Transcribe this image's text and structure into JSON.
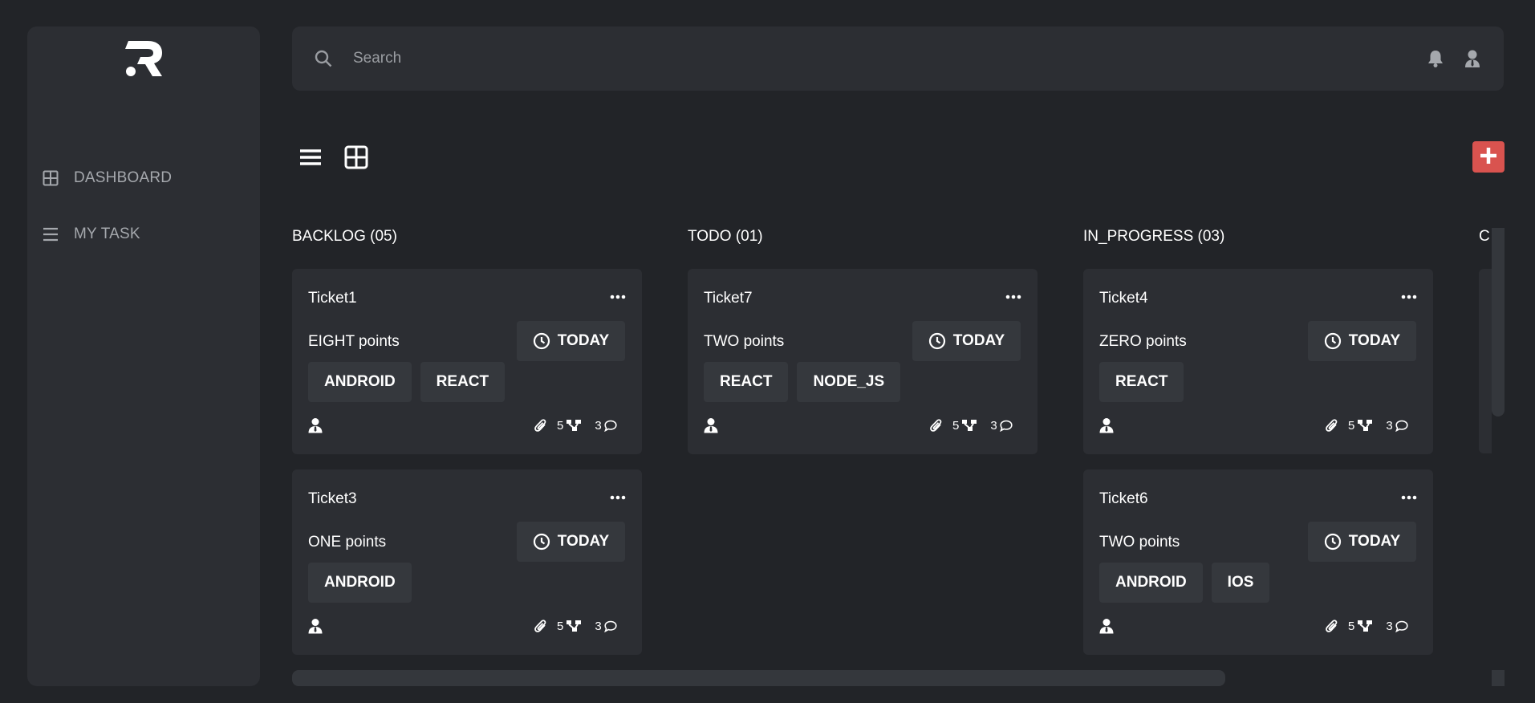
{
  "sidebar": {
    "logo": "R",
    "items": [
      {
        "label": "DASHBOARD",
        "icon": "grid-icon"
      },
      {
        "label": "MY TASK",
        "icon": "list-icon"
      }
    ]
  },
  "search": {
    "placeholder": "Search",
    "value": ""
  },
  "columns": [
    {
      "title": "BACKLOG (05)",
      "cards": [
        {
          "title": "Ticket1",
          "points": "EIGHT points",
          "due": "TODAY",
          "tags": [
            "ANDROID",
            "REACT"
          ],
          "subtasks": "5",
          "comments": "3"
        },
        {
          "title": "Ticket3",
          "points": "ONE points",
          "due": "TODAY",
          "tags": [
            "ANDROID"
          ],
          "subtasks": "5",
          "comments": "3"
        }
      ]
    },
    {
      "title": "TODO (01)",
      "cards": [
        {
          "title": "Ticket7",
          "points": "TWO points",
          "due": "TODAY",
          "tags": [
            "REACT",
            "NODE_JS"
          ],
          "subtasks": "5",
          "comments": "3"
        }
      ]
    },
    {
      "title": "IN_PROGRESS (03)",
      "cards": [
        {
          "title": "Ticket4",
          "points": "ZERO points",
          "due": "TODAY",
          "tags": [
            "REACT"
          ],
          "subtasks": "5",
          "comments": "3"
        },
        {
          "title": "Ticket6",
          "points": "TWO points",
          "due": "TODAY",
          "tags": [
            "ANDROID",
            "IOS"
          ],
          "subtasks": "5",
          "comments": "3"
        }
      ]
    }
  ],
  "peek_column": {
    "title": "C"
  },
  "colors": {
    "background": "#222428",
    "panel": "#2c2e33",
    "chip": "#35383d",
    "accent": "#d9534f",
    "muted_text": "#a5a8ad"
  }
}
